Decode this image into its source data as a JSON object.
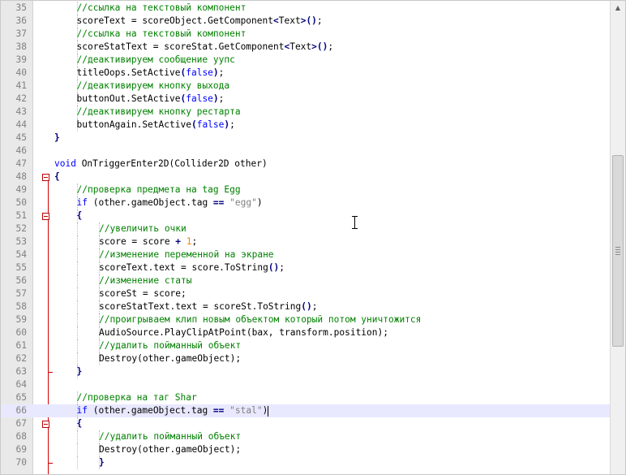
{
  "editor": {
    "lines": [
      {
        "n": "35",
        "indent": 2,
        "t": [
          [
            "cmt",
            "//ссылка на текстовый компонент"
          ]
        ]
      },
      {
        "n": "36",
        "indent": 2,
        "t": [
          [
            "p",
            "scoreText = scoreObject.GetComponent"
          ],
          [
            "op",
            "<"
          ],
          [
            "p",
            "Text"
          ],
          [
            "op",
            ">"
          ],
          [
            "op",
            "()"
          ],
          [
            "p",
            ";"
          ]
        ]
      },
      {
        "n": "37",
        "indent": 2,
        "t": [
          [
            "cmt",
            "//ссылка на текстовый компонент"
          ]
        ]
      },
      {
        "n": "38",
        "indent": 2,
        "t": [
          [
            "p",
            "scoreStatText = scoreStat.GetComponent"
          ],
          [
            "op",
            "<"
          ],
          [
            "p",
            "Text"
          ],
          [
            "op",
            ">"
          ],
          [
            "op",
            "()"
          ],
          [
            "p",
            ";"
          ]
        ]
      },
      {
        "n": "39",
        "indent": 2,
        "t": [
          [
            "cmt",
            "//деактивируем сообщение уупс"
          ]
        ]
      },
      {
        "n": "40",
        "indent": 2,
        "t": [
          [
            "p",
            "titleOops.SetActive"
          ],
          [
            "op",
            "("
          ],
          [
            "kw",
            "false"
          ],
          [
            "op",
            ")"
          ],
          [
            "p",
            ";"
          ]
        ]
      },
      {
        "n": "41",
        "indent": 2,
        "t": [
          [
            "cmt",
            "//деактивируем кнопку выхода"
          ]
        ]
      },
      {
        "n": "42",
        "indent": 2,
        "t": [
          [
            "p",
            "buttonOut.SetActive"
          ],
          [
            "op",
            "("
          ],
          [
            "kw",
            "false"
          ],
          [
            "op",
            ")"
          ],
          [
            "p",
            ";"
          ]
        ]
      },
      {
        "n": "43",
        "indent": 2,
        "t": [
          [
            "cmt",
            "//деактивируем кнопку рестарта"
          ]
        ]
      },
      {
        "n": "44",
        "indent": 2,
        "t": [
          [
            "p",
            "buttonAgain.SetActive"
          ],
          [
            "op",
            "("
          ],
          [
            "kw",
            "false"
          ],
          [
            "op",
            ")"
          ],
          [
            "p",
            ";"
          ]
        ]
      },
      {
        "n": "45",
        "indent": 1,
        "t": [
          [
            "op",
            "}"
          ]
        ]
      },
      {
        "n": "46",
        "indent": 0,
        "t": []
      },
      {
        "n": "47",
        "indent": 1,
        "t": [
          [
            "kw",
            "void"
          ],
          [
            "p",
            " OnTriggerEnter2D(Collider2D other)"
          ]
        ]
      },
      {
        "n": "48",
        "indent": 1,
        "t": [
          [
            "op",
            "{"
          ]
        ],
        "fold": true
      },
      {
        "n": "49",
        "indent": 2,
        "t": [
          [
            "cmt",
            "//проверка предмета на tag Egg"
          ]
        ]
      },
      {
        "n": "50",
        "indent": 2,
        "t": [
          [
            "kw",
            "if"
          ],
          [
            "p",
            " ("
          ],
          [
            "p",
            "other.gameObject.tag "
          ],
          [
            "op",
            "=="
          ],
          [
            "p",
            " "
          ],
          [
            "str",
            "\"egg\""
          ],
          [
            "p",
            ")"
          ]
        ]
      },
      {
        "n": "51",
        "indent": 2,
        "t": [
          [
            "op",
            "{"
          ]
        ],
        "fold": true
      },
      {
        "n": "52",
        "indent": 3,
        "t": [
          [
            "cmt",
            "//увеличить очки"
          ]
        ]
      },
      {
        "n": "53",
        "indent": 3,
        "t": [
          [
            "p",
            "score = score "
          ],
          [
            "op",
            "+"
          ],
          [
            "p",
            " "
          ],
          [
            "num",
            "1"
          ],
          [
            "p",
            ";"
          ]
        ]
      },
      {
        "n": "54",
        "indent": 3,
        "t": [
          [
            "cmt",
            "//изменение переменной на экране"
          ]
        ]
      },
      {
        "n": "55",
        "indent": 3,
        "t": [
          [
            "p",
            "scoreText.text = score.ToString"
          ],
          [
            "op",
            "()"
          ],
          [
            "p",
            ";"
          ]
        ]
      },
      {
        "n": "56",
        "indent": 3,
        "t": [
          [
            "cmt",
            "//изменение статы"
          ]
        ]
      },
      {
        "n": "57",
        "indent": 3,
        "t": [
          [
            "p",
            "scoreSt = score;"
          ]
        ]
      },
      {
        "n": "58",
        "indent": 3,
        "t": [
          [
            "p",
            "scoreStatText.text = scoreSt.ToString"
          ],
          [
            "op",
            "()"
          ],
          [
            "p",
            ";"
          ]
        ]
      },
      {
        "n": "59",
        "indent": 3,
        "t": [
          [
            "cmt",
            "//проигрываем клип новым объектом который потом уничтожится"
          ]
        ]
      },
      {
        "n": "60",
        "indent": 3,
        "t": [
          [
            "p",
            "AudioSource.PlayClipAtPoint(bax, transform.position);"
          ]
        ]
      },
      {
        "n": "61",
        "indent": 3,
        "t": [
          [
            "cmt",
            "//удалить пойманный объект"
          ]
        ]
      },
      {
        "n": "62",
        "indent": 3,
        "t": [
          [
            "p",
            "Destroy(other.gameObject);"
          ]
        ]
      },
      {
        "n": "63",
        "indent": 2,
        "t": [
          [
            "op",
            "}"
          ]
        ]
      },
      {
        "n": "64",
        "indent": 0,
        "t": []
      },
      {
        "n": "65",
        "indent": 2,
        "t": [
          [
            "cmt",
            "//проверка на таг Shar"
          ]
        ]
      },
      {
        "n": "66",
        "indent": 2,
        "t": [
          [
            "kw",
            "if"
          ],
          [
            "p",
            " ("
          ],
          [
            "p",
            "other.gameObject.tag "
          ],
          [
            "op",
            "=="
          ],
          [
            "p",
            " "
          ],
          [
            "str",
            "\"stal\""
          ],
          [
            "p",
            ")"
          ]
        ],
        "current": true
      },
      {
        "n": "67",
        "indent": 2,
        "t": [
          [
            "op",
            "{"
          ]
        ],
        "fold": true
      },
      {
        "n": "68",
        "indent": 3,
        "t": [
          [
            "cmt",
            "//удалить пойманный объект"
          ]
        ]
      },
      {
        "n": "69",
        "indent": 3,
        "t": [
          [
            "p",
            "Destroy(other.gameObject);"
          ]
        ]
      },
      {
        "n": "70",
        "indent": 3,
        "t": [
          [
            "op",
            "}"
          ]
        ]
      }
    ]
  },
  "scrollbar": {
    "position": 0.52,
    "up_icon": "scroll-up-arrow-icon"
  },
  "colors": {
    "comment": "#008000",
    "keyword": "#0000ff",
    "number": "#ff8000",
    "string": "#808080",
    "operator": "#000080",
    "current_line": "#e8e8ff",
    "fold_marker": "#c00000",
    "gutter": "#e9e9e9"
  }
}
